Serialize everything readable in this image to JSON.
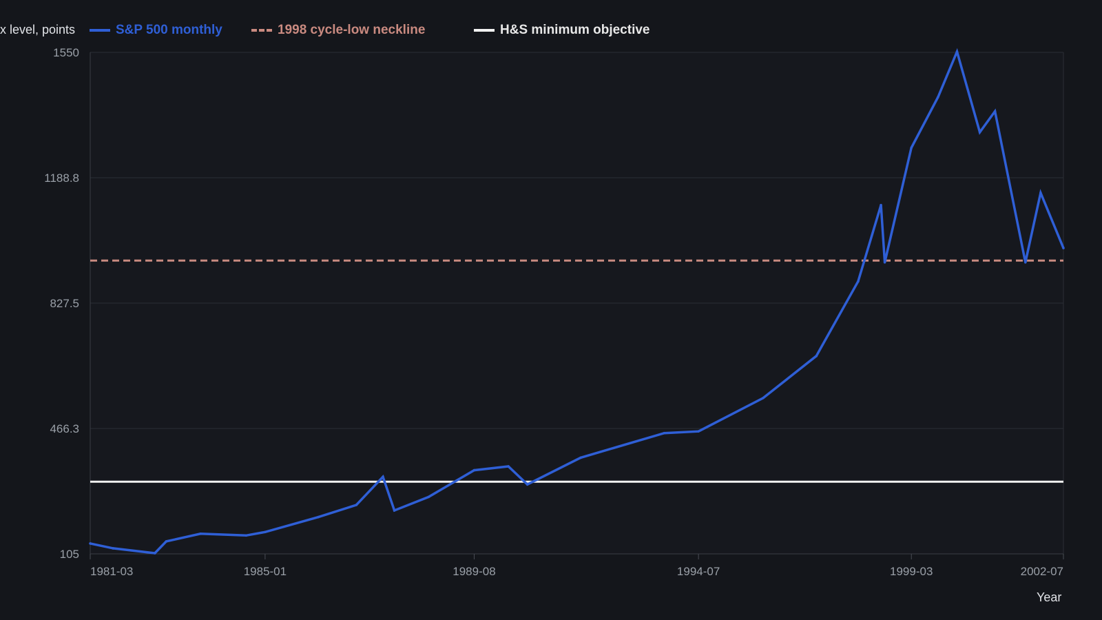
{
  "chart_data": {
    "type": "line",
    "ylabel": "x level, points",
    "xlabel": "Year",
    "ylim": [
      105,
      1550
    ],
    "y_ticks": [
      "1550",
      "1188.8",
      "827.5",
      "466.3",
      "105"
    ],
    "x_ticks": [
      "1981-03",
      "1985-01",
      "1989-08",
      "1994-07",
      "1999-03",
      "2002-07"
    ],
    "grid": true,
    "legend_position": "top",
    "series": [
      {
        "name": "S&P 500 monthly",
        "color": "#2f5fd6",
        "style": "solid",
        "points": [
          [
            "1981-03",
            135
          ],
          [
            "1981-09",
            121
          ],
          [
            "1982-08",
            107
          ],
          [
            "1982-11",
            141
          ],
          [
            "1983-08",
            163
          ],
          [
            "1984-08",
            158
          ],
          [
            "1985-01",
            168
          ],
          [
            "1986-03",
            211
          ],
          [
            "1987-01",
            246
          ],
          [
            "1987-08",
            327
          ],
          [
            "1987-11",
            230
          ],
          [
            "1988-08",
            269
          ],
          [
            "1989-08",
            346
          ],
          [
            "1990-05",
            357
          ],
          [
            "1990-10",
            305
          ],
          [
            "1991-12",
            382
          ],
          [
            "1993-10",
            453
          ],
          [
            "1994-07",
            458
          ],
          [
            "1995-12",
            554
          ],
          [
            "1997-02",
            675
          ],
          [
            "1998-01",
            890
          ],
          [
            "1998-07",
            1110
          ],
          [
            "1998-08",
            945
          ],
          [
            "1999-03",
            1275
          ],
          [
            "1999-10",
            1421
          ],
          [
            "2000-03",
            1552
          ],
          [
            "2000-09",
            1320
          ],
          [
            "2001-01",
            1380
          ],
          [
            "2001-09",
            945
          ],
          [
            "2002-01",
            1145
          ],
          [
            "2002-07",
            986
          ]
        ]
      },
      {
        "name": "1998 cycle-low neckline",
        "color": "#c98a80",
        "style": "dashed",
        "value": 950
      },
      {
        "name": "H&S minimum objective",
        "color": "#f2f2f2",
        "style": "solid",
        "value": 313
      }
    ]
  }
}
